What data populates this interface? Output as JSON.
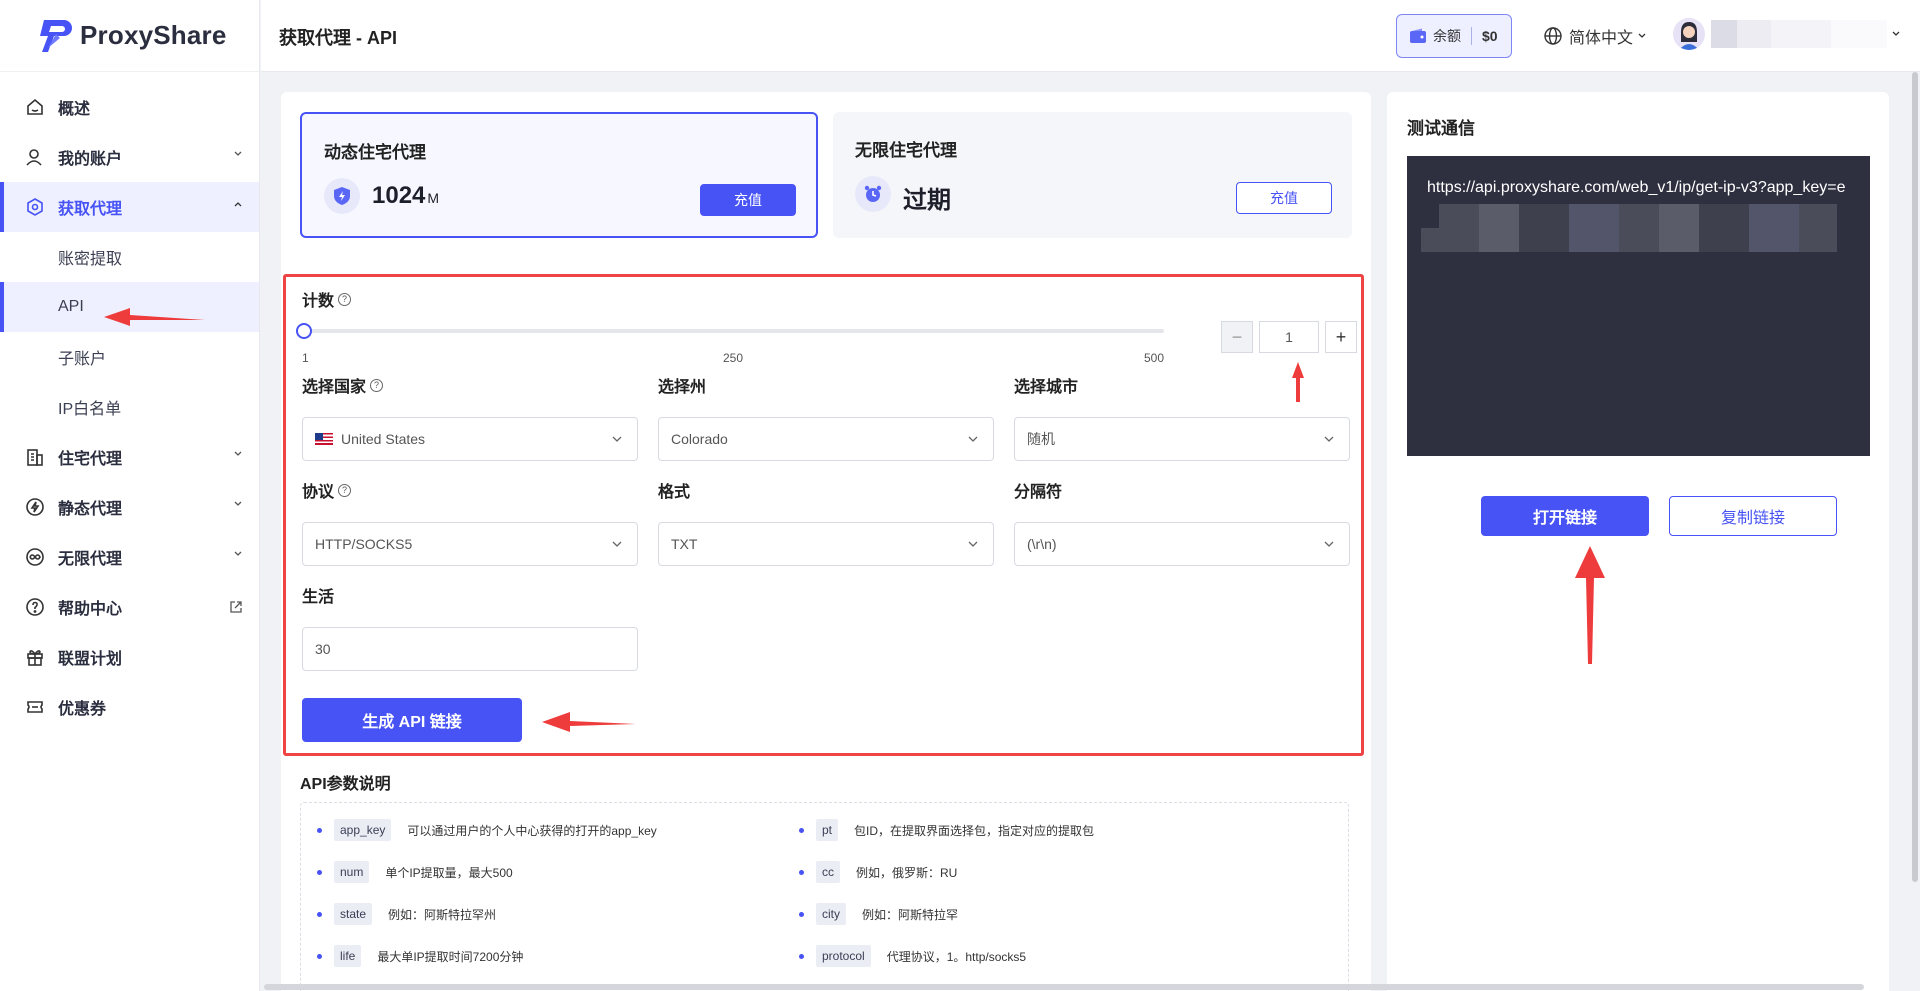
{
  "brand": {
    "name": "ProxyShare",
    "accent": "#4753f5"
  },
  "sidebar": {
    "items": [
      {
        "label": "概述",
        "icon": "home-icon"
      },
      {
        "label": "我的账户",
        "icon": "user-icon"
      },
      {
        "label": "获取代理",
        "icon": "target-icon"
      },
      {
        "label": "账密提取"
      },
      {
        "label": "API"
      },
      {
        "label": "子账户"
      },
      {
        "label": "IP白名单"
      },
      {
        "label": "住宅代理",
        "icon": "building-icon"
      },
      {
        "label": "静态代理",
        "icon": "bolt-icon"
      },
      {
        "label": "无限代理",
        "icon": "infinity-icon"
      },
      {
        "label": "帮助中心",
        "icon": "help-icon"
      },
      {
        "label": "联盟计划",
        "icon": "gift-icon"
      },
      {
        "label": "优惠券",
        "icon": "coupon-icon"
      }
    ]
  },
  "header": {
    "title": "获取代理 - API",
    "balance_label": "余额",
    "balance_amount": "$0",
    "language": "简体中文"
  },
  "plans": [
    {
      "title": "动态住宅代理",
      "value": "1024",
      "unit": "M",
      "button": "充值"
    },
    {
      "title": "无限住宅代理",
      "value": "过期",
      "button": "充值"
    }
  ],
  "form": {
    "count_label": "计数",
    "slider": {
      "min_label": "1",
      "mid_label": "250",
      "max_label": "500",
      "value": 1
    },
    "count_value": "1",
    "country_label": "选择国家",
    "country_value": "United States",
    "state_label": "选择州",
    "state_value": "Colorado",
    "city_label": "选择城市",
    "city_value": "随机",
    "protocol_label": "协议",
    "protocol_value": "HTTP/SOCKS5",
    "format_label": "格式",
    "format_value": "TXT",
    "separator_label": "分隔符",
    "separator_value": "(\\r\\n)",
    "life_label": "生活",
    "life_value": "30",
    "generate_button": "生成 API 链接"
  },
  "api_params": {
    "title": "API参数说明",
    "items": [
      {
        "key": "app_key",
        "desc": "可以通过用户的个人中心获得的打开的app_key"
      },
      {
        "key": "pt",
        "desc": "包ID，在提取界面选择包，指定对应的提取包"
      },
      {
        "key": "num",
        "desc": "单个IP提取量，最大500"
      },
      {
        "key": "cc",
        "desc": "例如，俄罗斯：RU"
      },
      {
        "key": "state",
        "desc": "例如：阿斯特拉罕州"
      },
      {
        "key": "city",
        "desc": "例如：阿斯特拉罕"
      },
      {
        "key": "life",
        "desc": "最大单IP提取时间7200分钟"
      },
      {
        "key": "protocol",
        "desc": "代理协议，1。http/socks5"
      }
    ]
  },
  "test": {
    "title": "测试通信",
    "url": "https://api.proxyshare.com/web_v1/ip/get-ip-v3?app_key=e",
    "open_button": "打开链接",
    "copy_button": "复制链接"
  }
}
